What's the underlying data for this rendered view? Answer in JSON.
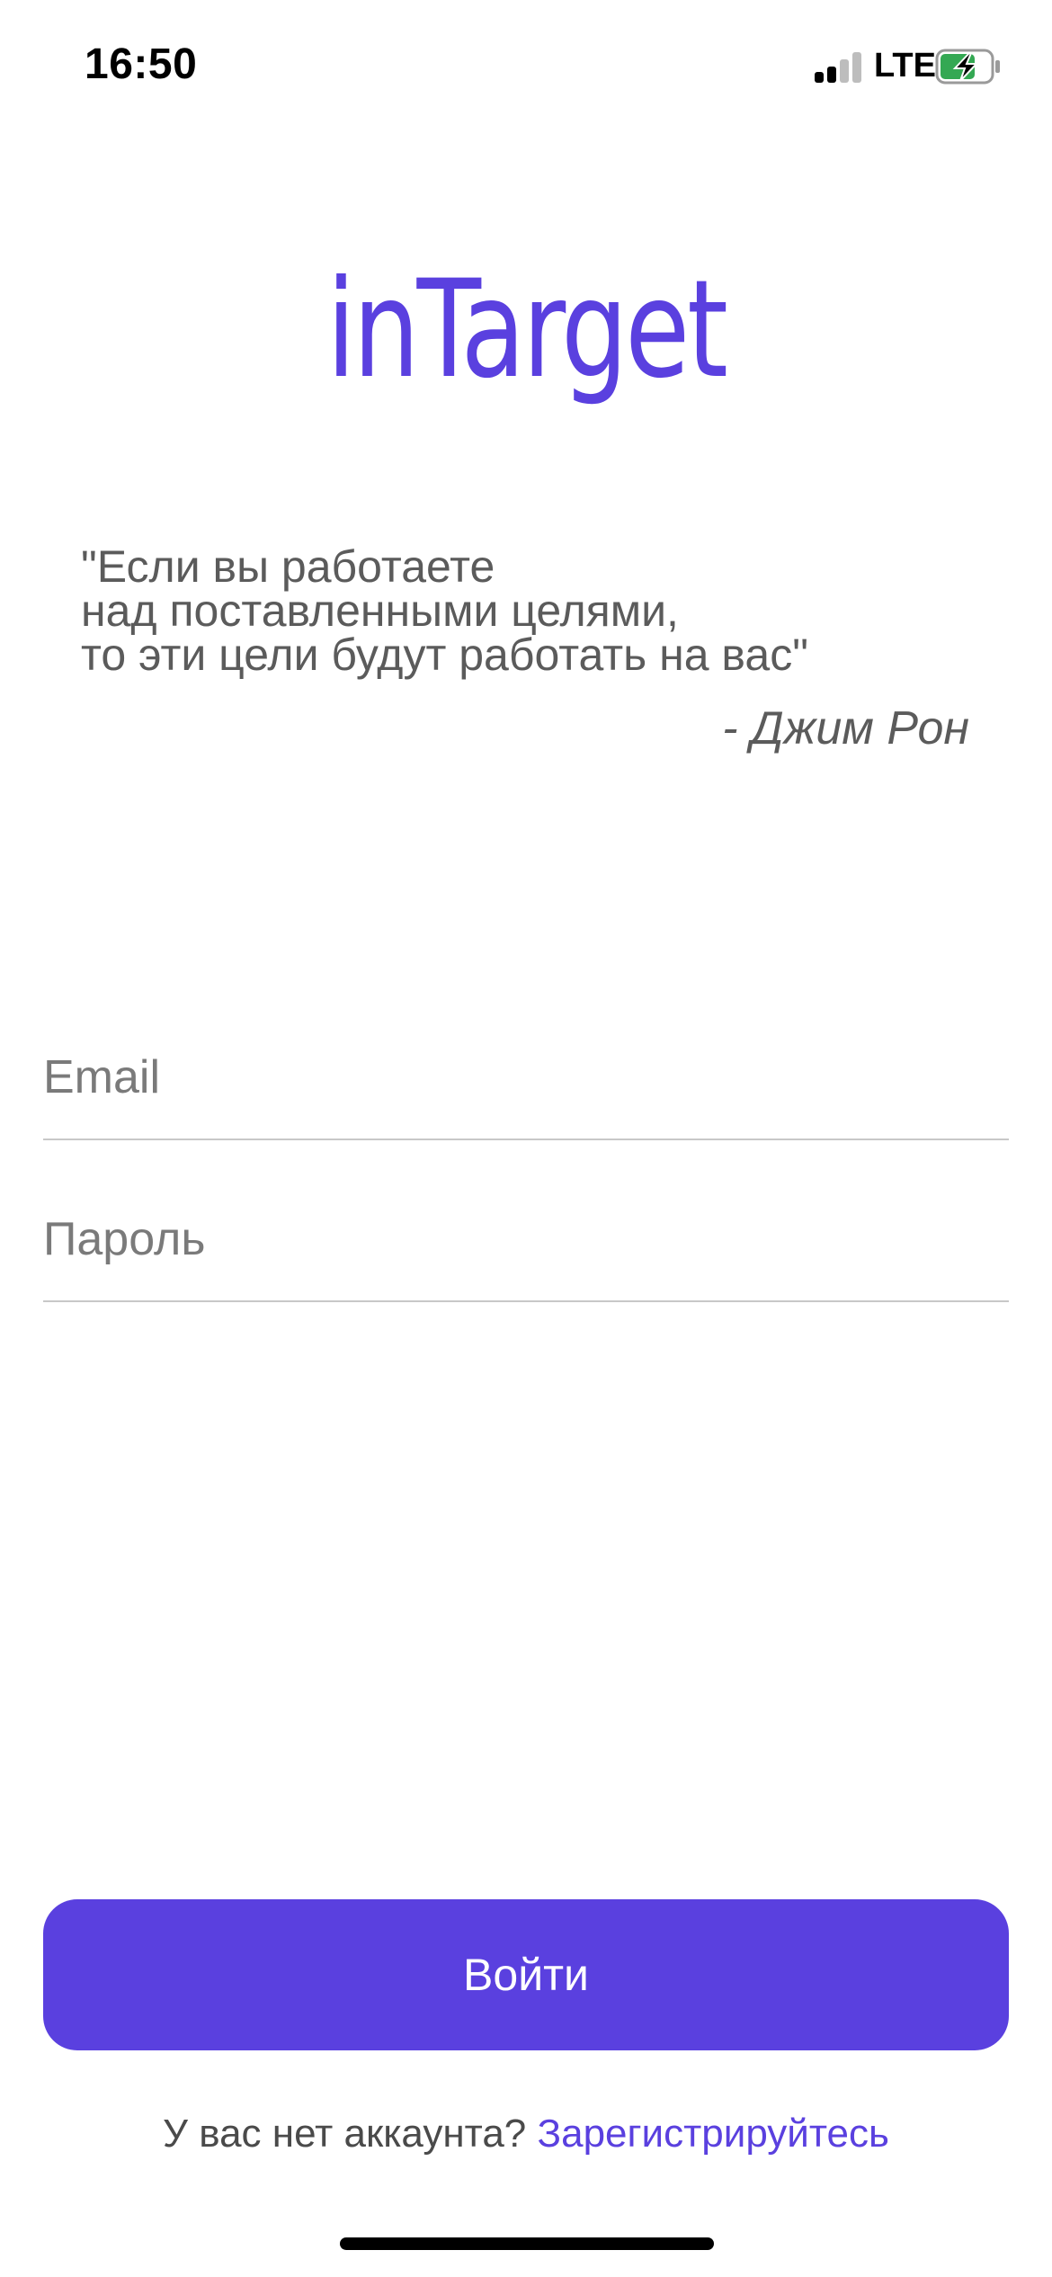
{
  "status_bar": {
    "time": "16:50",
    "network": "LTE",
    "signal_icon": "cellular-signal-icon",
    "battery_icon": "battery-charging-icon",
    "battery_color": "#34a853"
  },
  "app": {
    "logo_text": "inTarget",
    "brand_color": "#5a40df"
  },
  "quote": {
    "text": "\"Если вы работаете\nнад поставленными целями,\nто эти цели будут работать на вас\"",
    "author": "- Джим Рон"
  },
  "form": {
    "email": {
      "placeholder": "Email",
      "value": ""
    },
    "password": {
      "placeholder": "Пароль",
      "value": ""
    },
    "login_label": "Войти"
  },
  "register": {
    "prompt": "У вас нет аккаунта?",
    "link_label": "Зарегистрируйтесь"
  }
}
